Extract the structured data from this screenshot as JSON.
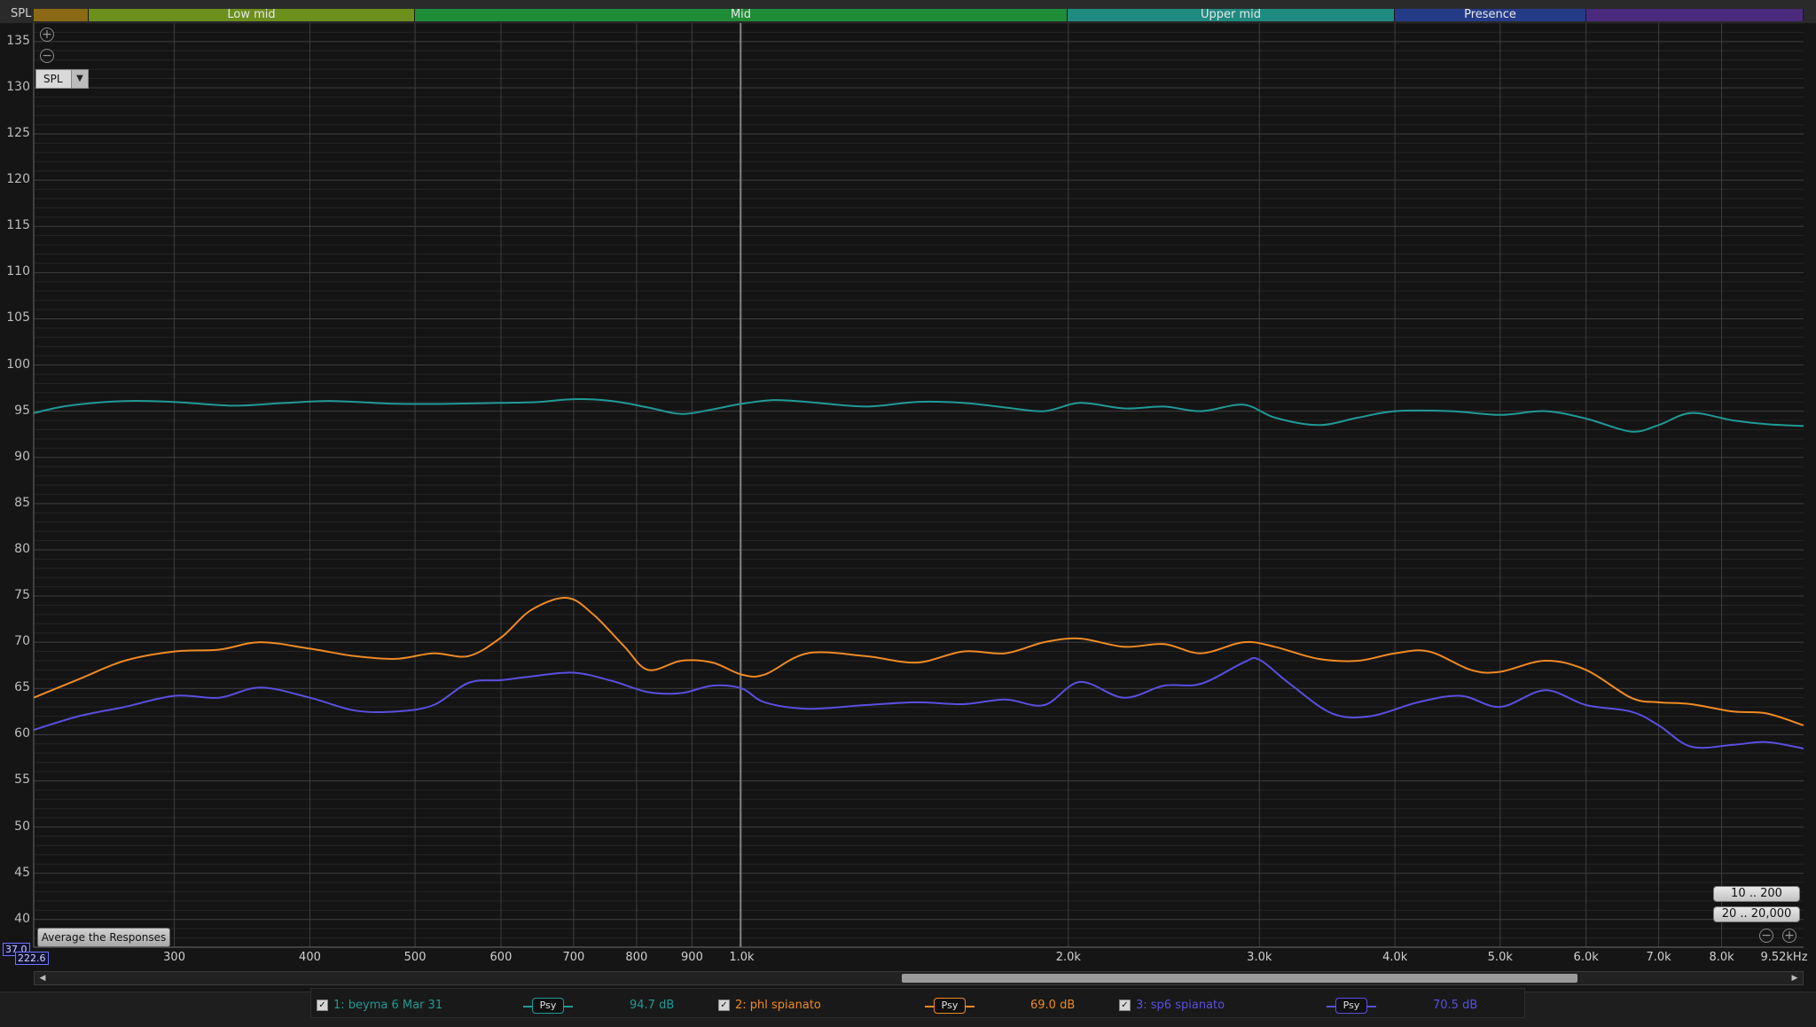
{
  "colors": {
    "teal": "#1f9a96",
    "orange": "#ee8a24",
    "purple": "#5a4fe0",
    "grid_major": "#3e3e3e",
    "grid_minor": "#242424"
  },
  "top_bar": {
    "label": "SPL",
    "bands": [
      {
        "name": "",
        "color": "#8a6a14"
      },
      {
        "name": "Low mid",
        "color": "#6d8f1c"
      },
      {
        "name": "Mid",
        "color": "#1f8c38"
      },
      {
        "name": "Upper mid",
        "color": "#1f8a80"
      },
      {
        "name": "Presence",
        "color": "#243c88"
      },
      {
        "name": "",
        "color": "#4a2a7c"
      }
    ]
  },
  "controls": {
    "spl_select_value": "SPL",
    "range_buttons": [
      "10 .. 200",
      "20 .. 20,000"
    ],
    "average_button": "Average the Responses",
    "cursor_y": "37.0",
    "cursor_x": "222.6"
  },
  "chart_data": {
    "type": "line",
    "xlabel": "",
    "ylabel": "",
    "x_scale": "log",
    "xlim": [
      222.6,
      9520
    ],
    "ylim": [
      37,
      137
    ],
    "y_ticks": [
      40,
      45,
      50,
      55,
      60,
      65,
      70,
      75,
      80,
      85,
      90,
      95,
      100,
      105,
      110,
      115,
      120,
      125,
      130,
      135
    ],
    "x_ticks": [
      {
        "value": 300,
        "label": "300"
      },
      {
        "value": 400,
        "label": "400"
      },
      {
        "value": 500,
        "label": "500"
      },
      {
        "value": 600,
        "label": "600"
      },
      {
        "value": 700,
        "label": "700"
      },
      {
        "value": 800,
        "label": "800"
      },
      {
        "value": 900,
        "label": "900"
      },
      {
        "value": 1000,
        "label": "1.0k"
      },
      {
        "value": 2000,
        "label": "2.0k"
      },
      {
        "value": 3000,
        "label": "3.0k"
      },
      {
        "value": 4000,
        "label": "4.0k"
      },
      {
        "value": 5000,
        "label": "5.0k"
      },
      {
        "value": 6000,
        "label": "6.0k"
      },
      {
        "value": 7000,
        "label": "7.0k"
      },
      {
        "value": 8000,
        "label": "8.0k"
      },
      {
        "value": 9520,
        "label": "9.52kHz"
      }
    ],
    "series": [
      {
        "name": "1: beyma 6 Mar 31",
        "color": "#1f9a96",
        "legend_value": "94.7 dB",
        "x": [
          222.6,
          240,
          270,
          300,
          340,
          380,
          420,
          480,
          540,
          600,
          650,
          700,
          760,
          820,
          880,
          940,
          1000,
          1070,
          1150,
          1300,
          1450,
          1600,
          1750,
          1900,
          2050,
          2250,
          2450,
          2650,
          2900,
          3100,
          3400,
          3700,
          4000,
          4500,
          5000,
          5500,
          6000,
          6600,
          7000,
          7500,
          8200,
          8800,
          9520
        ],
        "values": [
          94.8,
          95.6,
          96.1,
          96.0,
          95.6,
          95.9,
          96.1,
          95.8,
          95.8,
          95.9,
          96.0,
          96.3,
          96.1,
          95.4,
          94.7,
          95.2,
          95.8,
          96.2,
          96.0,
          95.5,
          96.0,
          95.9,
          95.4,
          95.0,
          95.9,
          95.3,
          95.5,
          95.0,
          95.7,
          94.3,
          93.5,
          94.3,
          95.0,
          95.0,
          94.6,
          95.0,
          94.2,
          92.8,
          93.5,
          94.8,
          94.0,
          93.6,
          93.4
        ]
      },
      {
        "name": "2: phl spianato",
        "color": "#ee8a24",
        "legend_value": "69.0 dB",
        "x": [
          222.6,
          245,
          270,
          300,
          330,
          360,
          400,
          440,
          480,
          520,
          560,
          600,
          640,
          690,
          730,
          780,
          820,
          880,
          940,
          1000,
          1050,
          1150,
          1300,
          1450,
          1600,
          1750,
          1900,
          2050,
          2250,
          2450,
          2650,
          2900,
          3100,
          3400,
          3700,
          4000,
          4300,
          4700,
          5000,
          5500,
          6000,
          6600,
          7000,
          7500,
          8200,
          8800,
          9520
        ],
        "values": [
          64.0,
          66.0,
          68.0,
          69.0,
          69.2,
          70.0,
          69.3,
          68.5,
          68.2,
          68.8,
          68.5,
          70.5,
          73.5,
          74.8,
          73.0,
          69.5,
          67.0,
          68.0,
          67.8,
          66.5,
          66.5,
          68.8,
          68.5,
          67.8,
          69.0,
          68.8,
          70.0,
          70.4,
          69.5,
          69.8,
          68.8,
          70.0,
          69.5,
          68.2,
          68.0,
          68.8,
          69.0,
          67.0,
          66.8,
          68.0,
          67.0,
          64.0,
          63.5,
          63.3,
          62.5,
          62.3,
          61.0
        ]
      },
      {
        "name": "3: sp6 spianato",
        "color": "#5a4fe0",
        "legend_value": "70.5 dB",
        "x": [
          222.6,
          245,
          270,
          300,
          330,
          360,
          400,
          440,
          480,
          520,
          560,
          600,
          640,
          700,
          760,
          820,
          880,
          940,
          1000,
          1050,
          1150,
          1300,
          1450,
          1600,
          1750,
          1900,
          2050,
          2250,
          2450,
          2650,
          2900,
          3000,
          3200,
          3500,
          3800,
          4200,
          4600,
          5000,
          5500,
          6000,
          6600,
          7000,
          7500,
          8200,
          8800,
          9520
        ],
        "values": [
          60.5,
          62.0,
          63.0,
          64.2,
          64.0,
          65.1,
          64.0,
          62.6,
          62.5,
          63.2,
          65.6,
          65.9,
          66.3,
          66.7,
          65.8,
          64.6,
          64.5,
          65.3,
          65.0,
          63.5,
          62.8,
          63.2,
          63.5,
          63.3,
          63.8,
          63.2,
          65.7,
          64.0,
          65.3,
          65.5,
          67.8,
          68.1,
          65.5,
          62.3,
          62.0,
          63.5,
          64.2,
          63.0,
          64.8,
          63.2,
          62.5,
          61.0,
          58.7,
          58.9,
          59.2,
          58.5
        ]
      }
    ]
  },
  "legend": [
    {
      "label": "1: beyma 6 Mar 31",
      "psy": "Psy",
      "value": "94.7 dB"
    },
    {
      "label": "2: phl spianato",
      "psy": "Psy",
      "value": "69.0 dB"
    },
    {
      "label": "3: sp6 spianato",
      "psy": "Psy",
      "value": "70.5 dB"
    }
  ]
}
